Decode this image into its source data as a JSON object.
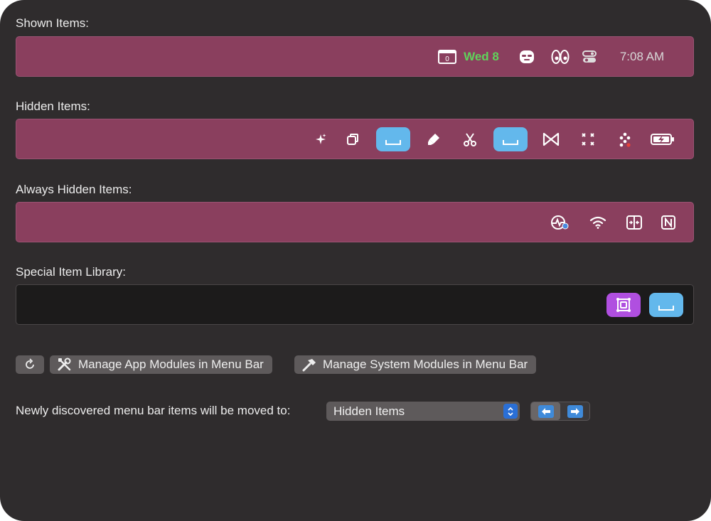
{
  "sections": {
    "shown": {
      "label": "Shown Items:"
    },
    "hidden": {
      "label": "Hidden Items:"
    },
    "always_hidden": {
      "label": "Always Hidden Items:"
    },
    "library": {
      "label": "Special Item Library:"
    }
  },
  "shown_items": {
    "calendar_day": "0",
    "date": "Wed 8",
    "time": "7:08 AM"
  },
  "colors": {
    "bar_bg": "#8a3f5e",
    "library_bg": "#1c1b1b",
    "spacer": "#63b8ec",
    "date_green": "#5fd35b",
    "accent_blue": "#2a6fd6",
    "library_purple": "#b04fe0"
  },
  "icons": {
    "shown": [
      "calendar-icon",
      "mask-icon",
      "eyes-icon",
      "toggle-icon"
    ],
    "hidden": [
      "sparkle-icon",
      "overlap-squares-icon",
      "spacer-icon",
      "highlighter-icon",
      "scissors-icon",
      "spacer-icon",
      "bartender-icon",
      "focus-arrows-icon",
      "dots-diamond-icon",
      "battery-charging-icon"
    ],
    "always_hidden": [
      "activity-monitor-icon",
      "wifi-icon",
      "split-view-icon",
      "notion-icon"
    ],
    "library": [
      "group-item-icon",
      "spacer-icon"
    ]
  },
  "buttons": {
    "refresh": "refresh-icon",
    "app_modules": "Manage App Modules in Menu Bar",
    "system_modules": "Manage System Modules in Menu Bar"
  },
  "footer": {
    "label": "Newly discovered menu bar items will be moved to:",
    "selected": "Hidden Items"
  }
}
